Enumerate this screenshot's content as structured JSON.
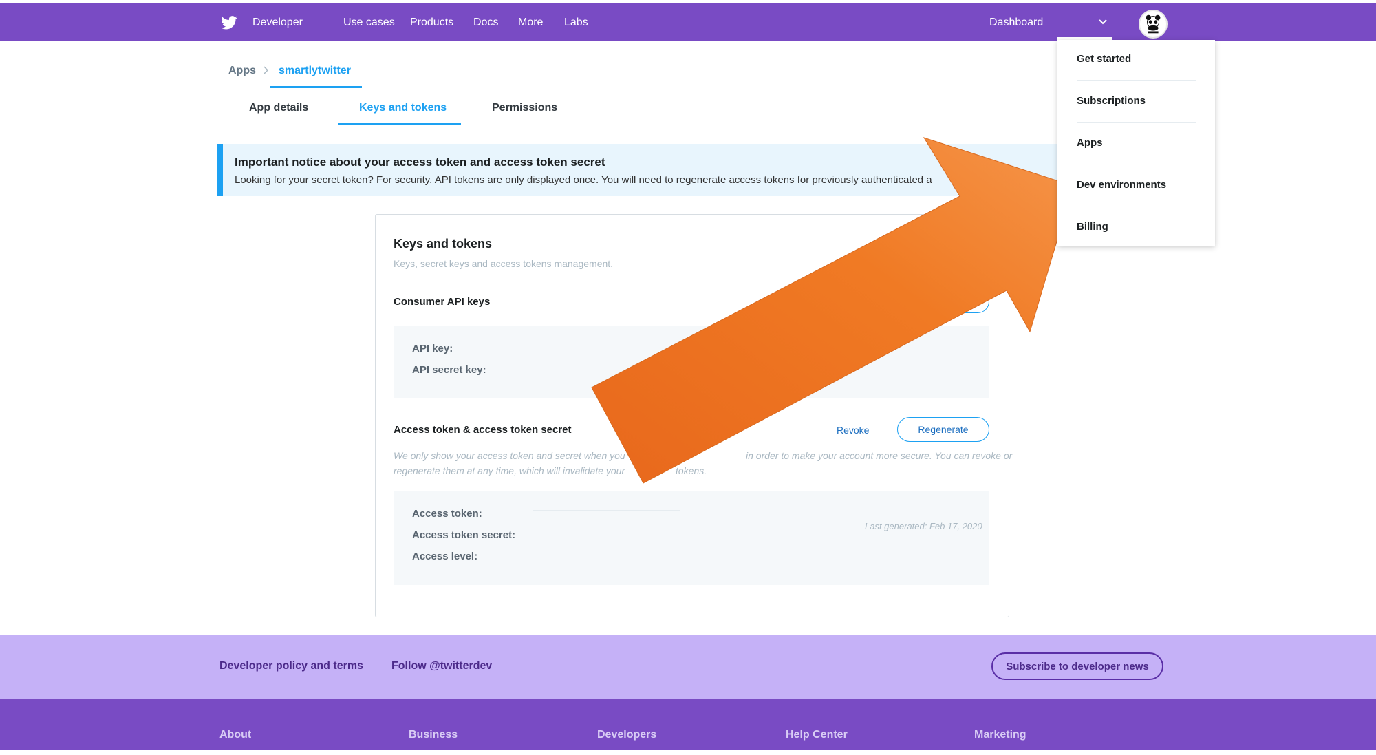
{
  "nav": {
    "brand": "Developer",
    "links": [
      "Use cases",
      "Products",
      "Docs",
      "More",
      "Labs"
    ],
    "dashboard": "Dashboard",
    "chevron_icon": "chevron-down-icon",
    "logo_icon": "twitter-bird-icon",
    "avatar_icon": "wwf-panda-avatar"
  },
  "breadcrumb": {
    "root": "Apps",
    "current": "smartlytwitter"
  },
  "tabs": [
    "App details",
    "Keys and tokens",
    "Permissions"
  ],
  "notice": {
    "title": "Important notice about your access token and access token secret",
    "body": "Looking for your secret token? For security, API tokens are only displayed once. You will need to regenerate access tokens for previously authenticated a"
  },
  "card": {
    "title": "Keys and tokens",
    "subtitle": "Keys, secret keys and access tokens management.",
    "consumer": {
      "title": "Consumer API keys",
      "fields": [
        "API key:",
        "API secret key:"
      ]
    },
    "access": {
      "title": "Access token & access token secret",
      "revoke": "Revoke",
      "regenerate": "Regenerate",
      "hint_line1": "We only show your access token and secret when you",
      "hint_line1b": "in order to make your account more secure. You can revoke or",
      "hint_line2": "regenerate them at any time, which will invalidate your",
      "hint_line2b": "tokens.",
      "fields": [
        "Access token:",
        "Access token secret:",
        "Access level:"
      ],
      "last_generated": "Last generated: Feb 17, 2020"
    }
  },
  "dropdown": {
    "items": [
      "Get started",
      "Subscriptions",
      "Apps",
      "Dev environments",
      "Billing"
    ]
  },
  "footer": {
    "policy": "Developer policy and terms",
    "follow": "Follow @twitterdev",
    "subscribe": "Subscribe to developer news",
    "columns": [
      "About",
      "Business",
      "Developers",
      "Help Center",
      "Marketing"
    ]
  },
  "colors": {
    "nav_purple": "#794bc4",
    "footer_light": "#c5b1f7",
    "accent_blue": "#1da1f2",
    "arrow_orange": "#f07a24"
  }
}
